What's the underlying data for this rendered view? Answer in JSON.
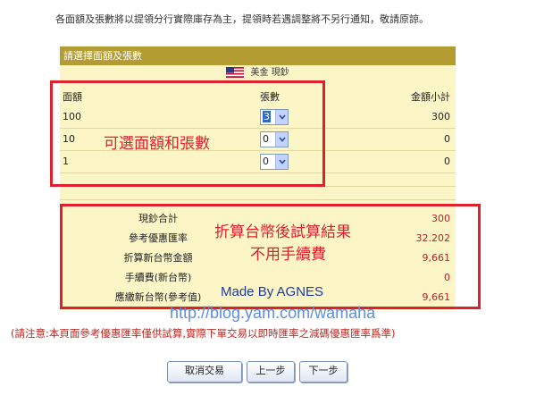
{
  "notice": "各面額及張數將以提領分行實際庫存為主，提領時若遇調整將不另行通知，敬請原諒。",
  "panel": {
    "title": "請選擇面額及張數",
    "currency": "美金 現鈔"
  },
  "table": {
    "headers": {
      "denomination": "面額",
      "quantity": "張數",
      "subtotal": "金額小計"
    },
    "rows": [
      {
        "denomination": "100",
        "quantity": "3",
        "subtotal": "300"
      },
      {
        "denomination": "10",
        "quantity": "0",
        "subtotal": "0"
      },
      {
        "denomination": "1",
        "quantity": "0",
        "subtotal": "0"
      }
    ]
  },
  "summary": [
    {
      "label": "現鈔合計",
      "value": "300"
    },
    {
      "label": "參考優惠匯率",
      "value": "32.202"
    },
    {
      "label": "折算新台幣金額",
      "value": "9,661"
    },
    {
      "label": "手續費(新台幣)",
      "value": "0"
    },
    {
      "label": "應繳新台幣(參考值)",
      "value": "9,661"
    }
  ],
  "annotations": {
    "select_note": "可選面額和張數",
    "result_note_line1": "折算台幣後試算結果",
    "result_note_line2": "不用手續費",
    "credit": "Made By AGNES",
    "url": "http://blog.yam.com/wamaha"
  },
  "disclaimer": "(請注意:本頁面參考優惠匯率僅供試算,實際下單交易以即時匯率之減碼優惠匯率爲準)",
  "buttons": {
    "cancel": "取消交易",
    "prev": "上一步",
    "next": "下一步"
  },
  "colors": {
    "header": "#b39d33",
    "panel_bg": "#fcf6c7",
    "annotation_red": "#e0202a",
    "value_red": "#b5252e"
  }
}
